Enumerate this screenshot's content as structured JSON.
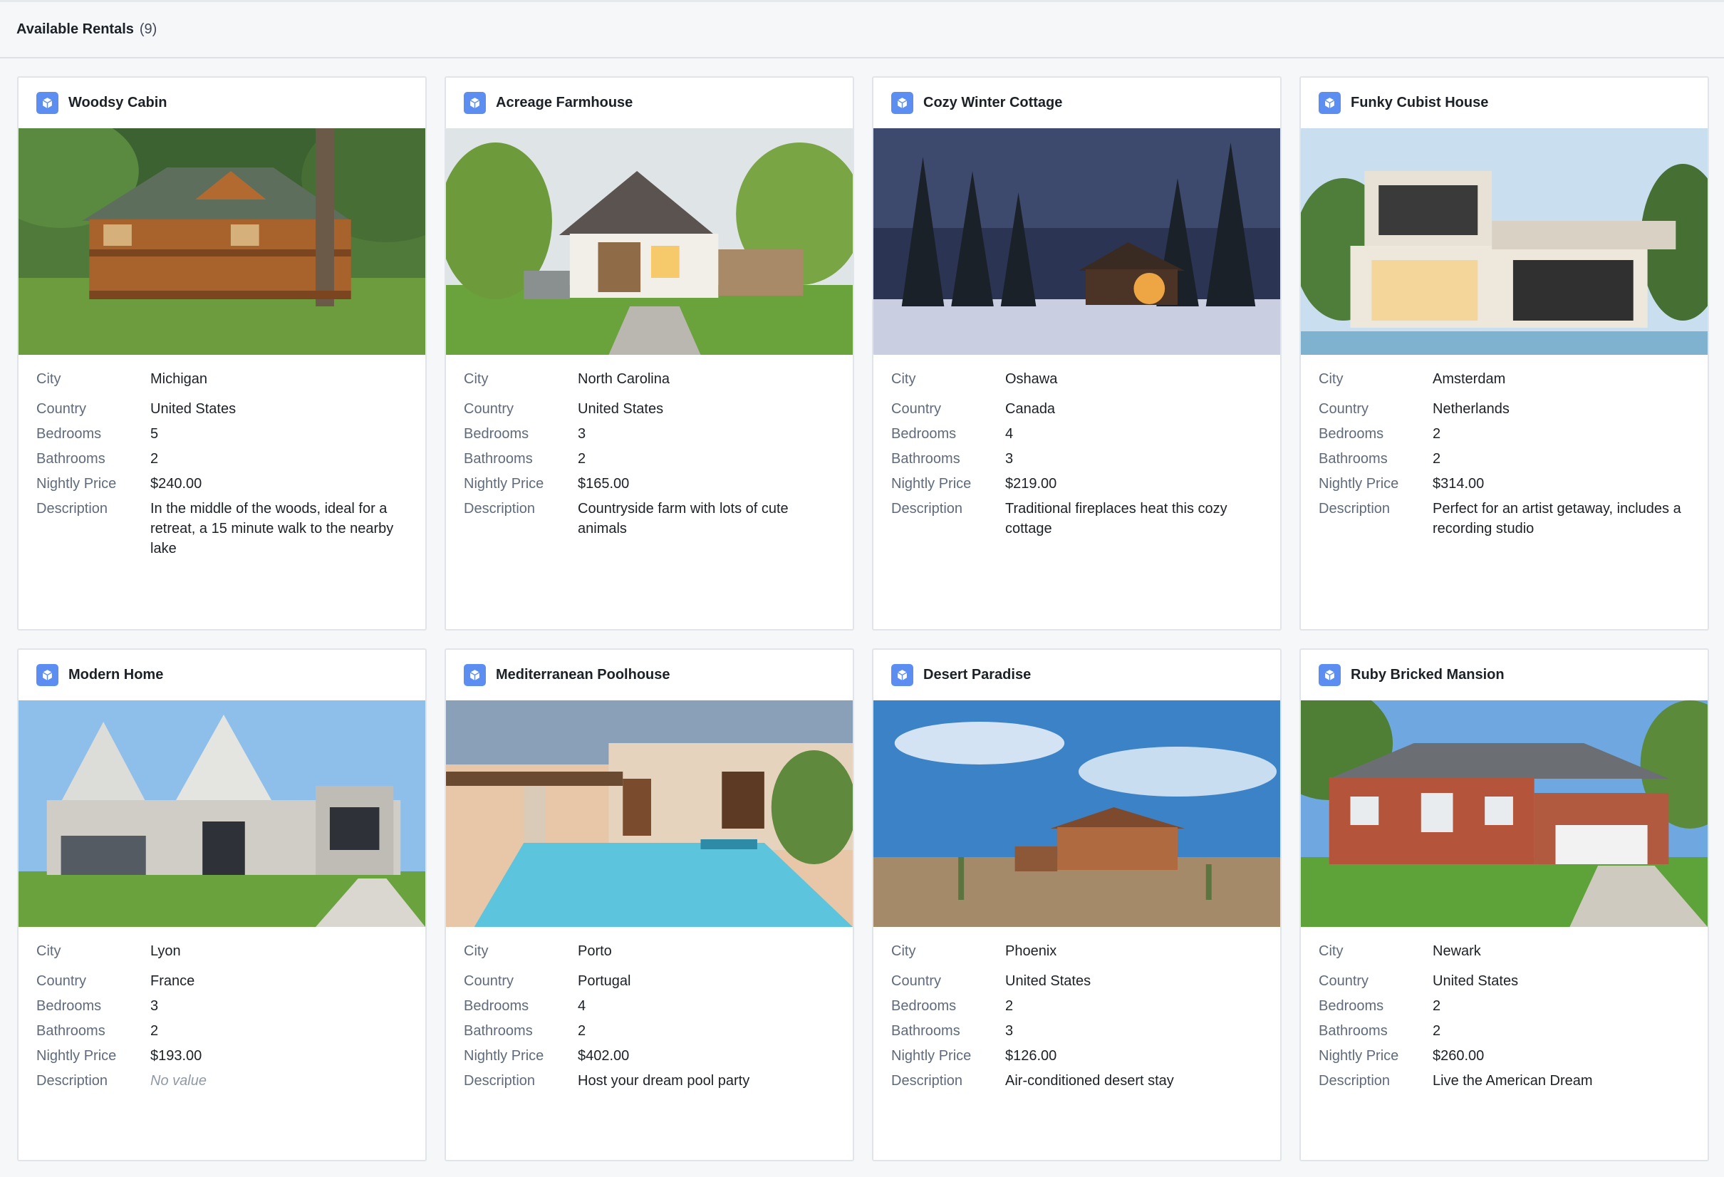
{
  "header": {
    "title": "Available Rentals",
    "count": "(9)"
  },
  "labels": {
    "city": "City",
    "country": "Country",
    "bedrooms": "Bedrooms",
    "bathrooms": "Bathrooms",
    "price": "Nightly Price",
    "description": "Description"
  },
  "colors": {
    "accent": "#5b8ef0",
    "page_bg": "#f5f7f9",
    "card_bg": "#ffffff"
  },
  "cards": [
    {
      "title": "Woodsy Cabin",
      "image": "log-cabin-photo",
      "city": "Michigan",
      "country": "United States",
      "bedrooms": "5",
      "bathrooms": "2",
      "price": "$240.00",
      "description": "In the middle of the woods, ideal for a retreat, a 15 minute walk to the nearby lake"
    },
    {
      "title": "Acreage Farmhouse",
      "image": "farmhouse-photo",
      "city": "North Carolina",
      "country": "United States",
      "bedrooms": "3",
      "bathrooms": "2",
      "price": "$165.00",
      "description": "Countryside farm with lots of cute animals"
    },
    {
      "title": "Cozy Winter Cottage",
      "image": "winter-cottage-photo",
      "city": "Oshawa",
      "country": "Canada",
      "bedrooms": "4",
      "bathrooms": "3",
      "price": "$219.00",
      "description": "Traditional fireplaces heat this cozy cottage"
    },
    {
      "title": "Funky Cubist House",
      "image": "cubist-house-photo",
      "city": "Amsterdam",
      "country": "Netherlands",
      "bedrooms": "2",
      "bathrooms": "2",
      "price": "$314.00",
      "description": "Perfect for an artist getaway, includes a recording studio"
    },
    {
      "title": "Modern Home",
      "image": "modern-home-photo",
      "city": "Lyon",
      "country": "France",
      "bedrooms": "3",
      "bathrooms": "2",
      "price": "$193.00",
      "description": "No value",
      "description_empty": true
    },
    {
      "title": "Mediterranean Poolhouse",
      "image": "poolhouse-photo",
      "city": "Porto",
      "country": "Portugal",
      "bedrooms": "4",
      "bathrooms": "2",
      "price": "$402.00",
      "description": "Host your dream pool party"
    },
    {
      "title": "Desert Paradise",
      "image": "desert-house-photo",
      "city": "Phoenix",
      "country": "United States",
      "bedrooms": "2",
      "bathrooms": "3",
      "price": "$126.00",
      "description": "Air-conditioned desert stay"
    },
    {
      "title": "Ruby Bricked Mansion",
      "image": "brick-mansion-photo",
      "city": "Newark",
      "country": "United States",
      "bedrooms": "2",
      "bathrooms": "2",
      "price": "$260.00",
      "description": "Live the American Dream"
    }
  ]
}
